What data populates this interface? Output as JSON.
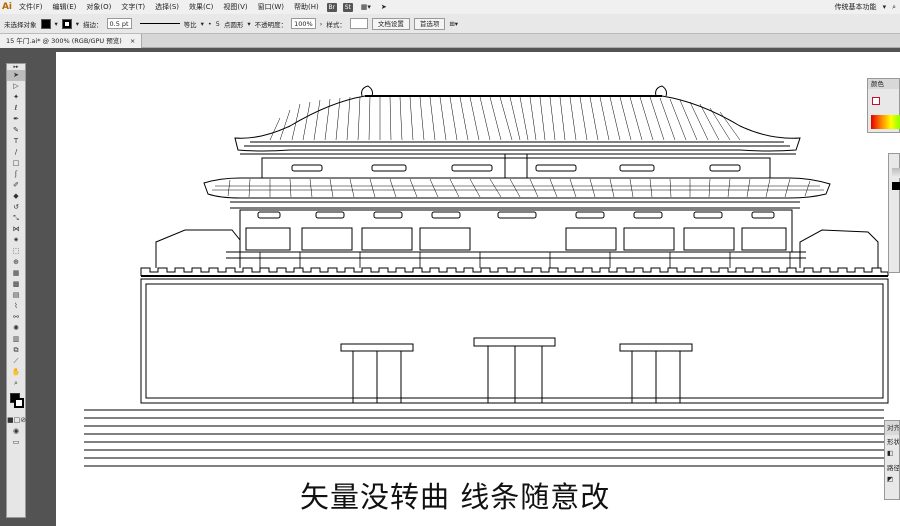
{
  "app": {
    "logo": "Ai",
    "workspace": "传统基本功能"
  },
  "menu": [
    "文件(F)",
    "编辑(E)",
    "对象(O)",
    "文字(T)",
    "选择(S)",
    "效果(C)",
    "视图(V)",
    "窗口(W)",
    "帮助(H)"
  ],
  "bridge": {
    "br": "Br",
    "st": "St"
  },
  "control": {
    "selection": "未选择对象",
    "stroke_label": "描边：",
    "stroke_value": "0.5 pt",
    "profile": "等比",
    "brush_value": "5",
    "brush_label": "点圆形",
    "opacity_label": "不透明度：",
    "opacity_value": "100%",
    "style_label": "样式：",
    "doc_setup": "文档设置",
    "prefs": "首选项"
  },
  "document": {
    "tab_label": "15 午门.ai* @ 300% (RGB/GPU 预览)",
    "close": "×"
  },
  "panels": {
    "color_title": "颜色",
    "align_title": "对齐",
    "shape_title": "形状模式",
    "path_title": "路径查"
  },
  "caption": "矢量没转曲 线条随意改",
  "colors": {
    "accent": "#c8102e",
    "panel_bg": "#e8e8e8",
    "canvas": "#535353"
  }
}
